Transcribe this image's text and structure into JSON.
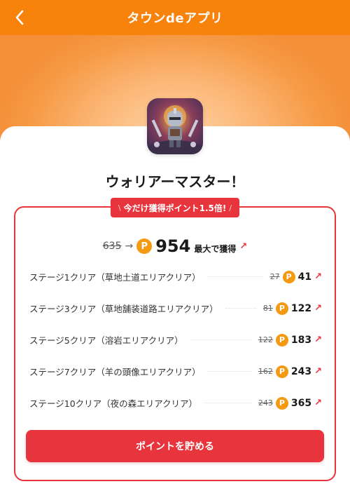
{
  "header": {
    "title": "タウンdeアプリ",
    "back_icon": "chevron-left-icon",
    "bg_color": "#f7820c"
  },
  "app": {
    "name": "ウォリアーマスター！",
    "icon": "warrior-knight-app-icon"
  },
  "promo": {
    "badge": "今だけ獲得ポイント1.5倍!",
    "old_total": "635",
    "new_total": "954",
    "max_label": "最大で獲得",
    "coin_symbol": "P",
    "accent_color": "#e8343c",
    "coin_color": "#f39a12"
  },
  "stages": [
    {
      "name": "ステージ1クリア（草地土道エリアクリア）",
      "old_points": "27",
      "new_points": "41"
    },
    {
      "name": "ステージ3クリア（草地舗装道路エリアクリア）",
      "old_points": "81",
      "new_points": "122"
    },
    {
      "name": "ステージ5クリア（溶岩エリアクリア）",
      "old_points": "122",
      "new_points": "183"
    },
    {
      "name": "ステージ7クリア（羊の頭像エリアクリア）",
      "old_points": "162",
      "new_points": "243"
    },
    {
      "name": "ステージ10クリア（夜の森エリアクリア）",
      "old_points": "243",
      "new_points": "365"
    }
  ],
  "cta": {
    "label": "ポイントを貯める"
  }
}
